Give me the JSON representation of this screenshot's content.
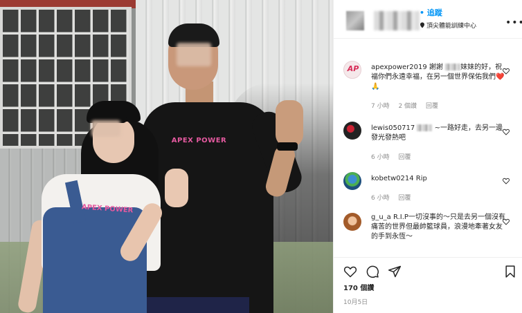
{
  "photo": {
    "shirt_logo_man": "APEX POWER",
    "shirt_logo_woman": "APEX POWER"
  },
  "header": {
    "follow_label": "• 追蹤",
    "location": "頂尖體能訓練中心",
    "more_icon": "more-horizontal-icon"
  },
  "comments": [
    {
      "username": "apexpower2019",
      "text_before": "謝謝",
      "text_after": "妹妹的好，祝福你們永遠幸福，在另一個世界保佑我們❤️🙏",
      "time": "7 小時",
      "likes": "2 個讚",
      "reply": "回覆",
      "avatar_text": "AP"
    },
    {
      "username": "lewis050717",
      "text_before": "",
      "text_after": "~一路好走，去另一邊發光發熱吧",
      "time": "6 小時",
      "likes": "",
      "reply": "回覆"
    },
    {
      "username": "kobetw0214",
      "text_before": "",
      "text_after": "Rip",
      "time": "6 小時",
      "likes": "",
      "reply": "回覆"
    },
    {
      "username": "g_u_a",
      "text_before": "",
      "text_after": "R.I.P一切沒事的～只是去另一個沒有痛苦的世界但最帥籃球員，浪漫地牽著女友的手到永恆～",
      "time": "",
      "likes": "",
      "reply": ""
    }
  ],
  "actions": {
    "like_icon": "heart-icon",
    "comment_icon": "comment-icon",
    "share_icon": "send-icon",
    "save_icon": "bookmark-icon"
  },
  "likes_count": "170 個讚",
  "date": "10月5日"
}
